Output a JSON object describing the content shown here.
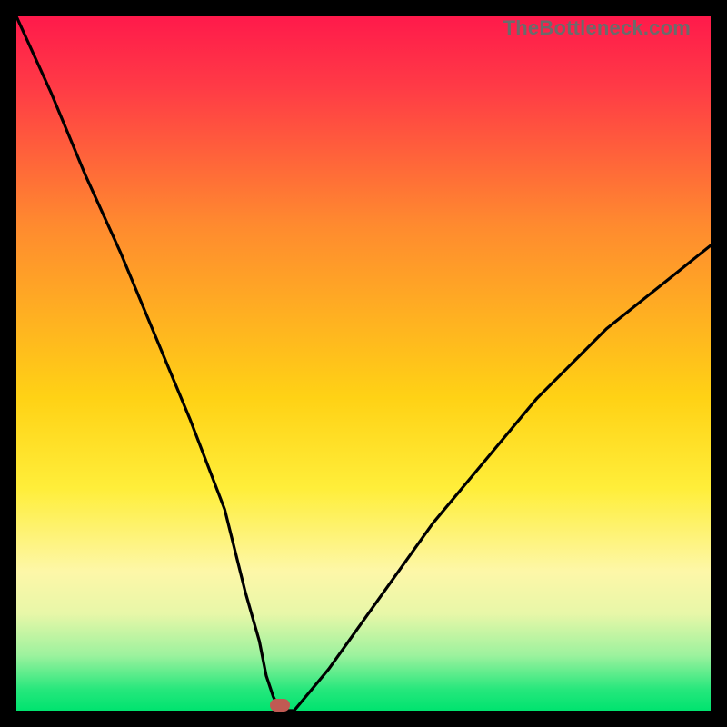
{
  "watermark": "TheBottleneck.com",
  "chart_data": {
    "type": "line",
    "title": "",
    "xlabel": "",
    "ylabel": "",
    "xlim": [
      0,
      100
    ],
    "ylim": [
      0,
      100
    ],
    "minimum_marker": {
      "x": 38,
      "y": 0
    },
    "series": [
      {
        "name": "curve",
        "x": [
          0,
          5,
          10,
          15,
          20,
          25,
          30,
          33,
          35,
          36,
          37,
          38,
          40,
          45,
          50,
          55,
          60,
          65,
          70,
          75,
          80,
          85,
          90,
          95,
          100
        ],
        "values": [
          100,
          89,
          77,
          66,
          54,
          42,
          29,
          17,
          10,
          5,
          2,
          0,
          0,
          6,
          13,
          20,
          27,
          33,
          39,
          45,
          50,
          55,
          59,
          63,
          67
        ]
      }
    ],
    "gradient_stops": [
      {
        "pos": 0,
        "color": "#ff1a4b"
      },
      {
        "pos": 30,
        "color": "#ff8a2f"
      },
      {
        "pos": 55,
        "color": "#ffd215"
      },
      {
        "pos": 80,
        "color": "#fdf7a8"
      },
      {
        "pos": 92,
        "color": "#9df29e"
      },
      {
        "pos": 100,
        "color": "#00e36f"
      }
    ]
  }
}
